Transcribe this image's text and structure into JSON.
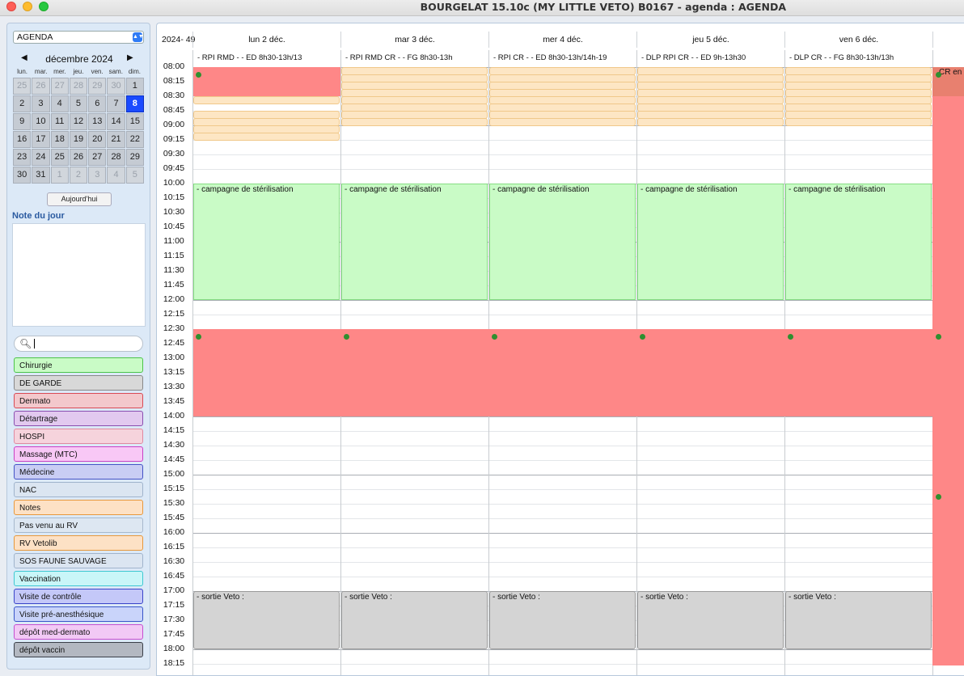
{
  "window": {
    "title": "BOURGELAT 15.10c (MY LITTLE VETO) B0167 - agenda : AGENDA"
  },
  "sidebar": {
    "agenda_select": "AGENDA",
    "month_label": "décembre 2024",
    "prev_symbol": "◀",
    "next_symbol": "▶",
    "weekdays": [
      "lun.",
      "mar.",
      "mer.",
      "jeu.",
      "ven.",
      "sam.",
      "dim."
    ],
    "days": [
      {
        "d": "25",
        "out": true
      },
      {
        "d": "26",
        "out": true
      },
      {
        "d": "27",
        "out": true
      },
      {
        "d": "28",
        "out": true
      },
      {
        "d": "29",
        "out": true
      },
      {
        "d": "30",
        "out": true
      },
      {
        "d": "1",
        "out": false
      },
      {
        "d": "2",
        "out": false
      },
      {
        "d": "3",
        "out": false
      },
      {
        "d": "4",
        "out": false
      },
      {
        "d": "5",
        "out": false
      },
      {
        "d": "6",
        "out": false
      },
      {
        "d": "7",
        "out": false
      },
      {
        "d": "8",
        "out": false,
        "selected": true
      },
      {
        "d": "9",
        "out": false
      },
      {
        "d": "10",
        "out": false
      },
      {
        "d": "11",
        "out": false
      },
      {
        "d": "12",
        "out": false
      },
      {
        "d": "13",
        "out": false
      },
      {
        "d": "14",
        "out": false
      },
      {
        "d": "15",
        "out": false
      },
      {
        "d": "16",
        "out": false
      },
      {
        "d": "17",
        "out": false
      },
      {
        "d": "18",
        "out": false
      },
      {
        "d": "19",
        "out": false
      },
      {
        "d": "20",
        "out": false
      },
      {
        "d": "21",
        "out": false
      },
      {
        "d": "22",
        "out": false
      },
      {
        "d": "23",
        "out": false
      },
      {
        "d": "24",
        "out": false
      },
      {
        "d": "25",
        "out": false
      },
      {
        "d": "26",
        "out": false
      },
      {
        "d": "27",
        "out": false
      },
      {
        "d": "28",
        "out": false
      },
      {
        "d": "29",
        "out": false
      },
      {
        "d": "30",
        "out": false
      },
      {
        "d": "31",
        "out": false
      },
      {
        "d": "1",
        "out": true
      },
      {
        "d": "2",
        "out": true
      },
      {
        "d": "3",
        "out": true
      },
      {
        "d": "4",
        "out": true
      },
      {
        "d": "5",
        "out": true
      }
    ],
    "today_button": "Aujourd'hui",
    "note_label": "Note du jour",
    "search_value": "",
    "categories": [
      {
        "label": "Chirurgie",
        "bg": "#c9fbc6",
        "border": "#4cc34a"
      },
      {
        "label": "DE GARDE",
        "bg": "#d8d8d8",
        "border": "#888888"
      },
      {
        "label": "Dermato",
        "bg": "#f3c8cc",
        "border": "#d94a55"
      },
      {
        "label": "Détartrage",
        "bg": "#e2c9ef",
        "border": "#8a4fb0"
      },
      {
        "label": "HOSPI",
        "bg": "#f6d3dc",
        "border": "#e089a0"
      },
      {
        "label": "Massage (MTC)",
        "bg": "#f8c8f6",
        "border": "#c941c4"
      },
      {
        "label": "Médecine",
        "bg": "#c9cdf4",
        "border": "#4453c6"
      },
      {
        "label": "NAC",
        "bg": "#dbe5f1",
        "border": "#a0b4cc"
      },
      {
        "label": "Notes",
        "bg": "#fde1c5",
        "border": "#e8983c"
      },
      {
        "label": "Pas venu au RV",
        "bg": "#dde7f2",
        "border": "#a7b9cd"
      },
      {
        "label": "RV Vetolib",
        "bg": "#fde1c5",
        "border": "#e6983c"
      },
      {
        "label": "SOS FAUNE SAUVAGE",
        "bg": "#dbe5f1",
        "border": "#a0b4cc"
      },
      {
        "label": "Vaccination",
        "bg": "#c9f6f8",
        "border": "#3fc8d2"
      },
      {
        "label": "Visite de contrôle",
        "bg": "#c4c8f8",
        "border": "#3a45c9"
      },
      {
        "label": "Visite pré-anesthésique",
        "bg": "#c9d4fa",
        "border": "#3856c9"
      },
      {
        "label": "dépôt med-dermato",
        "bg": "#f2c9f5",
        "border": "#c64fd0"
      },
      {
        "label": "dépôt vaccin",
        "bg": "#b3b8c1",
        "border": "#3a3f48"
      }
    ]
  },
  "agenda": {
    "week_label": "2024- 49",
    "columns": [
      {
        "header": "lun 2 déc.",
        "sub": "- RPI RMD - - ED 8h30-13h/13"
      },
      {
        "header": "mar 3 déc.",
        "sub": "- RPI RMD CR - - FG 8h30-13h"
      },
      {
        "header": "mer 4 déc.",
        "sub": "- RPI CR - - ED 8h30-13h/14h-19"
      },
      {
        "header": "jeu 5 déc.",
        "sub": "- DLP RPI CR - - ED 9h-13h30"
      },
      {
        "header": "ven 6 déc.",
        "sub": "- DLP CR - - FG 8h30-13h/13h"
      }
    ],
    "times": [
      "08:00",
      "08:15",
      "08:30",
      "08:45",
      "09:00",
      "09:15",
      "09:30",
      "09:45",
      "10:00",
      "10:15",
      "10:30",
      "10:45",
      "11:00",
      "11:15",
      "11:30",
      "11:45",
      "12:00",
      "12:15",
      "12:30",
      "12:45",
      "13:00",
      "13:15",
      "13:30",
      "13:45",
      "14:00",
      "14:15",
      "14:30",
      "14:45",
      "15:00",
      "15:15",
      "15:30",
      "15:45",
      "16:00",
      "16:15",
      "16:30",
      "16:45",
      "17:00",
      "17:15",
      "17:30",
      "17:45",
      "18:00",
      "18:15"
    ],
    "campaign_label": "- campagne de stérilisation",
    "sortie_label": "- sortie Veto :",
    "partial_col_label": "CR en",
    "colors": {
      "red": "#fe8787",
      "green": "#c9fbc6",
      "gray": "#d4d4d4",
      "orange": "#fde6c4"
    }
  }
}
